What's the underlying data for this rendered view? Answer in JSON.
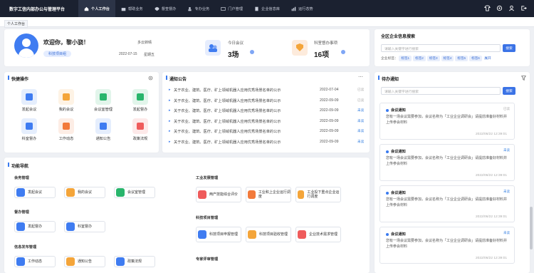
{
  "nav": {
    "brand": "数字工信内部办公与管理平台",
    "items": [
      {
        "label": "个人工作台",
        "active": true
      },
      {
        "label": "帮助业务"
      },
      {
        "label": "督查督办"
      },
      {
        "label": "专办业务"
      },
      {
        "label": "门户管理"
      },
      {
        "label": "企业信息库"
      },
      {
        "label": "运行态势"
      }
    ]
  },
  "breadcrumb": "个人工作台",
  "profile": {
    "greeting": "欢迎你，黎小骁！",
    "dept_tag": "科技项目组",
    "name_small": "多云转晴",
    "date": "2022-07-15",
    "weekday": "星期五"
  },
  "stats": [
    {
      "label": "今日会议",
      "value": "3场"
    },
    {
      "label": "科室督办事项",
      "value": "16项"
    }
  ],
  "quick": {
    "title": "快捷操作",
    "items": [
      "发起会议",
      "我的会议",
      "会议室管理",
      "发起督办",
      "科室督办",
      "工作动态",
      "通知公告",
      "政策法规"
    ],
    "colors": [
      "#3f7cf1",
      "#f4a53a",
      "#29b56c",
      "#29b56c",
      "#3f7cf1",
      "#f27a3b",
      "#3f7cf1",
      "#ef5b5b"
    ]
  },
  "notices": {
    "title": "通知公告",
    "items": [
      {
        "text": "关于农业、建筑、医疗、矿上领域机器人应用优秀场景名单的公示",
        "date": "2022-07-04",
        "status": "已读"
      },
      {
        "text": "关于农业、建筑、医疗、矿上领域机器人应用优秀场景名单的公示",
        "date": "2022-09-09",
        "status": "已读"
      },
      {
        "text": "关于农业、建筑、医疗、矿上领域机器人应用优秀场景名单的公示",
        "date": "2022-09-09",
        "status": "未读"
      },
      {
        "text": "关于农业、建筑、医疗、矿上领域机器人应用优秀场景名单的公示",
        "date": "2022-09-09",
        "status": "未读"
      },
      {
        "text": "关于农业、建筑、医疗、矿上领域机器人应用优秀场景名单的公示",
        "date": "2022-09-09",
        "status": "未读"
      },
      {
        "text": "关于农业、建筑、医疗、矿上领域机器人应用优秀场景名单的公示",
        "date": "2022-09-09",
        "status": "未读"
      }
    ]
  },
  "funcnav": {
    "title": "功能导航",
    "groups": [
      {
        "title": "会务管理",
        "items": [
          "发起会议",
          "我的会议",
          "会议室管理"
        ]
      },
      {
        "title": "督办管理",
        "items": [
          "发起督办",
          "科室督办"
        ]
      },
      {
        "title": "信息发布管理",
        "items": [
          "工作动态",
          "通知公告",
          "政策法规"
        ]
      },
      {
        "title": "工业发展管理",
        "items": [
          "两产技能综合评价",
          "工业和上企业运行调度",
          "工业投下重点企业运行调度"
        ]
      },
      {
        "title": "科技项目管理",
        "items": [
          "科技项目申报管理",
          "科技项目验收管理",
          "企业技术需求管理"
        ]
      },
      {
        "title": "专家评审管理",
        "items": []
      }
    ]
  },
  "search": {
    "title": "全区企业信息搜索",
    "placeholder": "请输入关键字进行搜索",
    "button": "搜索",
    "label": "企业标签：",
    "tags": [
      "标签1",
      "标签2",
      "标签3",
      "标签4",
      "标签5",
      "标签6"
    ],
    "expand": "展开"
  },
  "todo": {
    "title": "待办通知",
    "placeholder": "请输入关键字进行搜索",
    "button": "搜索",
    "items": [
      {
        "title": "会议通知",
        "tag": "已读",
        "text": "您有一场会议需要参加，会议名称为「工业企业调研会」请提前准备好材料并上传参会材料",
        "date": "2022/06/22 12:39:01"
      },
      {
        "title": "会议通知",
        "tag": "未读",
        "text": "您有一场会议需要参加，会议名称为「工业企业调研会」请提前准备好材料并上传参会材料",
        "date": "2022/06/22 12:39:01"
      },
      {
        "title": "会议通知",
        "tag": "未读",
        "text": "您有一场会议需要参加，会议名称为「工业企业调研会」请提前准备好材料并上传参会材料",
        "date": "2022/06/22 12:39:01"
      },
      {
        "title": "会议通知",
        "tag": "未读",
        "text": "您有一场会议需要参加，会议名称为「工业企业调研会」请提前准备好材料并上传参会材料",
        "date": "2022/06/22 12:39:01"
      }
    ]
  }
}
